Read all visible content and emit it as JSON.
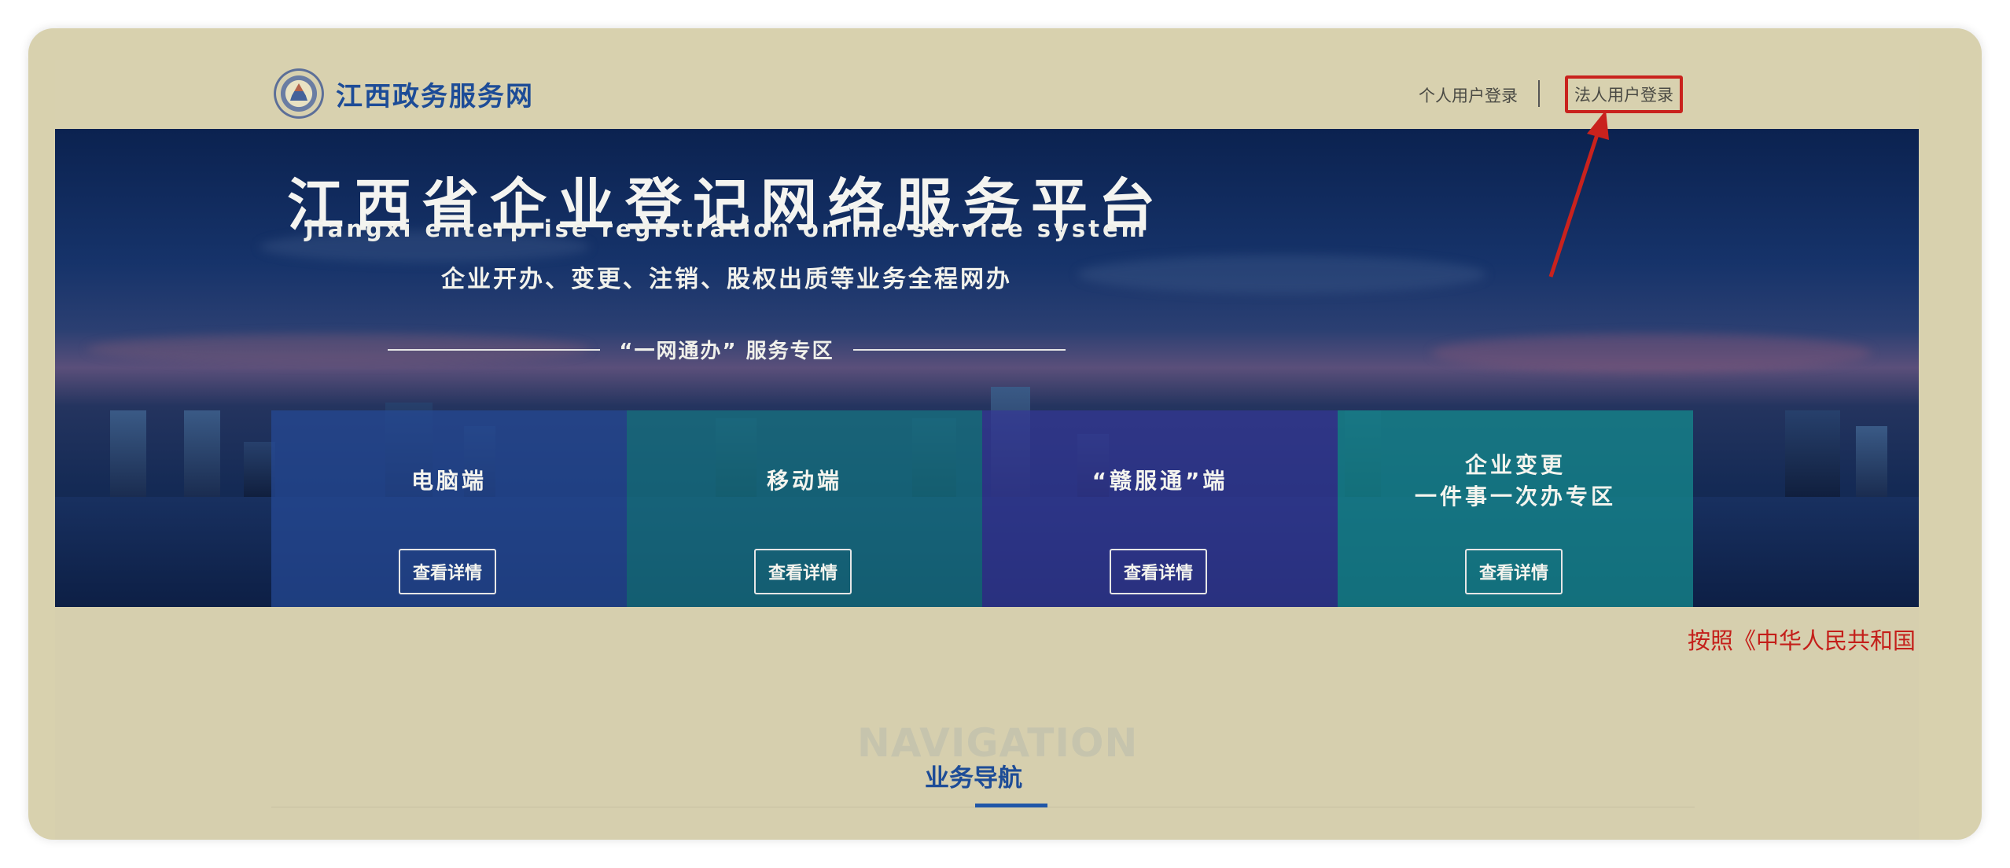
{
  "header": {
    "site_title": "江西政务服务网",
    "login_personal": "个人用户登录",
    "login_legal": "法人用户登录"
  },
  "banner": {
    "title": "江西省企业登记网络服务平台",
    "subtitle_en": "Jiangxi enterprise registration online service system",
    "tagline": "企业开办、变更、注销、股权出质等业务全程网办",
    "section_label": "“一网通办” 服务专区"
  },
  "cards": [
    {
      "title": "电脑端",
      "button": "查看详情"
    },
    {
      "title": "移动端",
      "button": "查看详情"
    },
    {
      "title": "“赣服通”端",
      "button": "查看详情"
    },
    {
      "title_line1": "企业变更",
      "title_line2": "一件事一次办专区",
      "button": "查看详情"
    }
  ],
  "notice": {
    "marquee_text": "按照《中华人民共和国"
  },
  "navigation": {
    "bg_text": "NAVIGATION",
    "title": "业务导航"
  },
  "colors": {
    "annotation_red": "#c9221d",
    "brand_blue": "#1d4c97"
  }
}
